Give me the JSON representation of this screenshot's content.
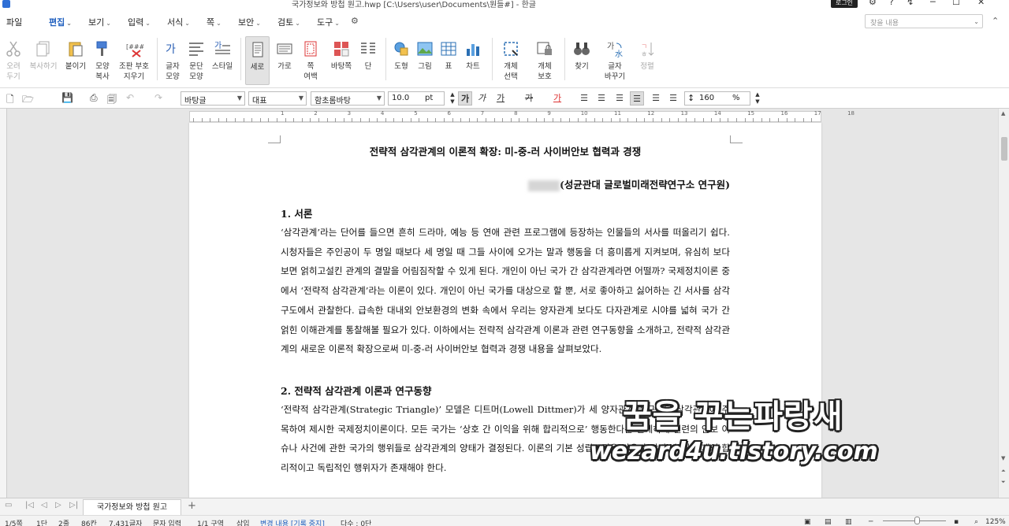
{
  "window": {
    "title": "국가정보와 방첩 원고.hwp [C:\\Users\\user\\Documents\\원들#] - 한글",
    "login_label": "로그인"
  },
  "menu": {
    "items": [
      "파일",
      "편집",
      "보기",
      "입력",
      "서식",
      "쪽",
      "보안",
      "검토",
      "도구"
    ],
    "active": "편집",
    "search_placeholder": "찾을 내용"
  },
  "ribbon": {
    "buttons": [
      {
        "label": "오려\n두기",
        "icon": "scissors-icon",
        "disabled": true
      },
      {
        "label": "복사하기",
        "icon": "copy-icon",
        "disabled": true
      },
      {
        "label": "붙이기",
        "icon": "paste-icon",
        "disabled": false
      },
      {
        "label": "모양\n복사",
        "icon": "format-painter-icon",
        "disabled": false
      },
      {
        "label": "조판 부호\n지우기",
        "icon": "clear-codes-icon",
        "disabled": false
      },
      {
        "label": "글자\n모양",
        "icon": "char-shape-icon",
        "disabled": false
      },
      {
        "label": "문단\n모양",
        "icon": "para-shape-icon",
        "disabled": false
      },
      {
        "label": "스타일",
        "icon": "style-icon",
        "disabled": false
      },
      {
        "label": "세로",
        "icon": "portrait-icon",
        "disabled": false
      },
      {
        "label": "가로",
        "icon": "landscape-icon",
        "disabled": false
      },
      {
        "label": "쪽\n여백",
        "icon": "page-margin-icon",
        "disabled": false
      },
      {
        "label": "바탕쪽",
        "icon": "master-page-icon",
        "disabled": false
      },
      {
        "label": "단",
        "icon": "columns-icon",
        "disabled": false
      },
      {
        "label": "도형",
        "icon": "shape-icon",
        "disabled": false
      },
      {
        "label": "그림",
        "icon": "picture-icon",
        "disabled": false
      },
      {
        "label": "표",
        "icon": "table-icon",
        "disabled": false
      },
      {
        "label": "차트",
        "icon": "chart-icon",
        "disabled": false
      },
      {
        "label": "개체\n선택",
        "icon": "object-select-icon",
        "disabled": false
      },
      {
        "label": "개체\n보호",
        "icon": "object-protect-icon",
        "disabled": false
      },
      {
        "label": "찾기",
        "icon": "binoculars-icon",
        "disabled": false
      },
      {
        "label": "글자\n바꾸기",
        "icon": "replace-icon",
        "disabled": false
      },
      {
        "label": "정렬",
        "icon": "sort-icon",
        "disabled": true
      }
    ]
  },
  "format": {
    "style": "바탕글",
    "lang": "대표",
    "font": "함초롬바탕",
    "size": "10.0",
    "size_unit": "pt",
    "bold": "가",
    "italic": "가",
    "underline": "가",
    "strike": "가",
    "color": "가",
    "line_spacing": "160",
    "line_spacing_unit": "%"
  },
  "ruler": {
    "numbers": [
      "1",
      "2",
      "3",
      "4",
      "5",
      "6",
      "7",
      "8",
      "9",
      "10",
      "11",
      "12",
      "13",
      "14",
      "15",
      "16",
      "17",
      "18"
    ]
  },
  "document": {
    "title": "전략적 삼각관계의 이론적 확장: 미-중-러 사이버안보 협력과 경쟁",
    "author": "(성균관대 글로벌미래전략연구소 연구원)",
    "section1_heading": "1. 서론",
    "section1_body": "‘삼각관계’라는 단어를 들으면 흔히 드라마, 예능 등 연애 관련 프로그램에 등장하는 인물들의 서사를 떠올리기 쉽다. 시청자들은 주인공이 두 명일 때보다 세 명일 때 그들 사이에 오가는 말과 행동을 더 흥미롭게 지켜보며, 유심히 보다 보면 얽히고설킨 관계의 결말을 어림짐작할 수 있게 된다. 개인이 아닌 국가 간 삼각관계라면 어떨까? 국제정치이론 중에서 ‘전략적 삼각관계’라는 이론이 있다. 개인이 아닌 국가를 대상으로 할 뿐, 서로 좋아하고 싫어하는 긴 서사를 삼각 구도에서 관찰한다. 급속한 대내외 안보환경의 변화 속에서 우리는 양자관계 보다도 다자관계로 시야를 넓혀 국가 간 얽힌 이해관계를 통찰해볼 필요가 있다. 이하에서는 전략적 삼각관계 이론과 관련 연구동향을 소개하고, 전략적 삼각관계의 새로운 이론적 확장으로써 미-중-러 사이버안보 협력과 경쟁 내용을 살펴보았다.",
    "section2_heading": "2. 전략적 삼각관계 이론과 연구동향",
    "section2_body": "‘전략적 삼각관계(Strategic Triangle)’ 모델은 디트머(Lowell Dittmer)가 세 양자관계로 구성된 삼각관계에 주목하여 제시한 국제정치이론이다. 모든 국가는 ‘상호 간 이익을 위해 합리적으로’ 행동한다는 전제하에 일련의 안보 이슈나 사건에 관한 국가의 행위들로 삼각관계의 양태가 결정된다. 이론의 기본 성립조건은 다음과 같다. 첫째, 3개의 합리적이고 독립적인 행위자가 존재해야 한다."
  },
  "tabs": {
    "sheet": "국가정보와 방첩 원고"
  },
  "watermark": {
    "line1": "꿈을 꾸는파랑새",
    "line2": "wezard4u.tistory.com"
  },
  "status": {
    "page": "1/5쪽",
    "column": "1단",
    "line": "2줄",
    "col": "86칸",
    "chars": "7,431글자",
    "mode": "문자 입력",
    "section": "1/1 구역",
    "insert": "삽입",
    "track": "변경 내용 [기록 중지]",
    "multicol": "다수 : 0단",
    "zoom": "125%"
  },
  "colors": {
    "accent": "#1f5fbf"
  }
}
